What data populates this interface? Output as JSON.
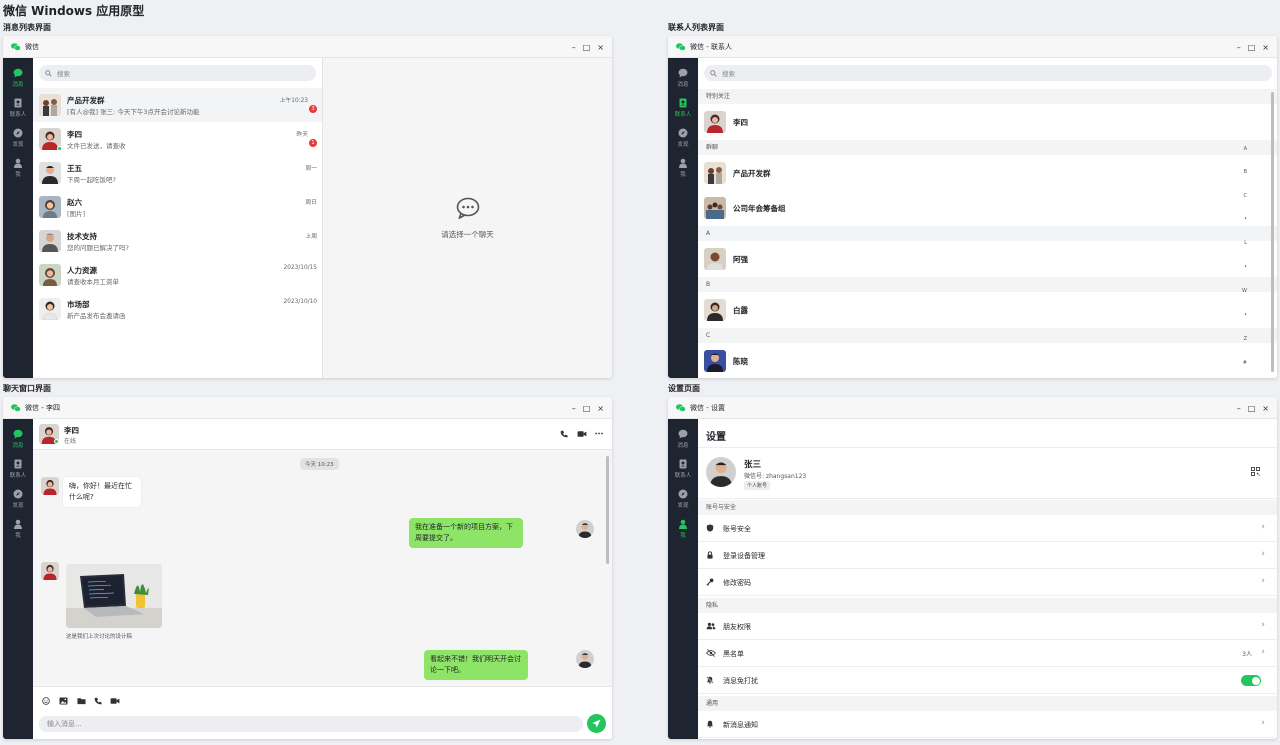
{
  "page": {
    "title": "微信 Windows 应用原型"
  },
  "sections": {
    "list": "消息列表界面",
    "contacts": "联系人列表界面",
    "chat": "聊天窗口界面",
    "settings": "设置页面"
  },
  "nav": {
    "messages": "消息",
    "contacts": "联系人",
    "discover": "发现",
    "me": "我"
  },
  "window_controls": {
    "min": "–",
    "max": "□",
    "close": "×"
  },
  "win1": {
    "title": "微信",
    "search_placeholder": "搜索",
    "empty_hint": "请选择一个聊天",
    "conversations": [
      {
        "name": "产品开发群",
        "preview": "[有人@我] 张三: 今天下午3点开会讨论新功能",
        "time": "上午10:23",
        "badge": "3"
      },
      {
        "name": "李四",
        "preview": "文件已发送，请查收",
        "time": "昨天",
        "badge": "1"
      },
      {
        "name": "王五",
        "preview": "下周一起吃饭吧?",
        "time": "周一"
      },
      {
        "name": "赵六",
        "preview": "[图片]",
        "time": "周日"
      },
      {
        "name": "技术支持",
        "preview": "您的问题已解决了吗?",
        "time": "上周"
      },
      {
        "name": "人力资源",
        "preview": "请查收本月工资单",
        "time": "2023/10/15"
      },
      {
        "name": "市场部",
        "preview": "新产品发布会邀请函",
        "time": "2023/10/10"
      }
    ]
  },
  "win2": {
    "title": "微信 - 联系人",
    "search_placeholder": "搜索",
    "groups": {
      "special": "特别关注",
      "groupchat": "群聊",
      "a": "A",
      "b": "B",
      "c": "C"
    },
    "contacts": {
      "lisi": "李四",
      "dev": "产品开发群",
      "annual": "公司年会筹备组",
      "aqiang": "阿强",
      "bailu": "白露",
      "chenxiao": "陈晓"
    },
    "alpha_index": [
      "A",
      "B",
      "C",
      "•",
      "L",
      "•",
      "W",
      "•",
      "Z",
      "#"
    ]
  },
  "win3": {
    "title": "微信 - 李四",
    "contact_name": "李四",
    "contact_status": "在线",
    "timestamp": "今天 10:23",
    "messages": [
      {
        "text": "嗨，你好！最近在忙什么呢?"
      },
      {
        "text": "我在准备一个新的项目方案，下周要提交了。"
      },
      {
        "caption": "这是我们上次讨论的设计稿"
      },
      {
        "text": "看起来不错！我们明天开会讨论一下吧。"
      }
    ],
    "input_placeholder": "输入消息..."
  },
  "win4": {
    "title": "微信 - 设置",
    "heading": "设置",
    "profile": {
      "name": "张三",
      "wechat_id": "微信号: zhangsan123",
      "tag": "个人账号"
    },
    "groups": {
      "account": "账号与安全",
      "privacy": "隐私",
      "general": "通用"
    },
    "items": {
      "security": "账号安全",
      "devices": "登录设备管理",
      "password": "修改密码",
      "friends": "朋友权限",
      "blacklist": "黑名单",
      "dnd": "消息免打扰",
      "notify": "新消息通知"
    },
    "blacklist_count": "3人",
    "dnd_enabled": true,
    "toggle_color": "#22c55e"
  },
  "colors": {
    "accent": "#22c55e",
    "sidebar": "#1e2430",
    "outgoing_bubble": "#8ee466",
    "badge": "#e53935"
  }
}
